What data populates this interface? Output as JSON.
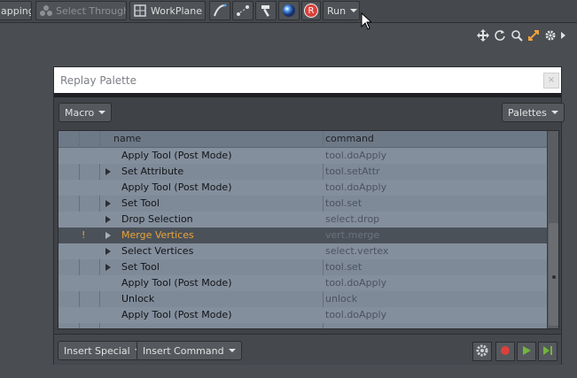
{
  "toolbar": {
    "snapping_label": "apping",
    "select_through_label": "Select Through",
    "workplane_label": "WorkPlane",
    "run_label": "Run",
    "r_badge": "R"
  },
  "palette": {
    "title": "Replay Palette",
    "close_label": "×",
    "macro_label": "Macro",
    "palettes_label": "Palettes",
    "columns": {
      "name": "name",
      "command": "command"
    },
    "rows": [
      {
        "name": "Apply Tool (Post Mode)",
        "command": "tool.doApply",
        "expandable": false,
        "alt": true,
        "selected": false,
        "mark": ""
      },
      {
        "name": "Set Attribute",
        "command": "tool.setAttr",
        "expandable": true,
        "alt": false,
        "selected": false,
        "mark": ""
      },
      {
        "name": "Apply Tool (Post Mode)",
        "command": "tool.doApply",
        "expandable": false,
        "alt": true,
        "selected": false,
        "mark": ""
      },
      {
        "name": "Set Tool",
        "command": "tool.set",
        "expandable": true,
        "alt": false,
        "selected": false,
        "mark": ""
      },
      {
        "name": "Drop Selection",
        "command": "select.drop",
        "expandable": true,
        "alt": true,
        "selected": false,
        "mark": ""
      },
      {
        "name": "Merge Vertices",
        "command": "vert.merge",
        "expandable": true,
        "alt": false,
        "selected": true,
        "mark": "!"
      },
      {
        "name": "Select Vertices",
        "command": "select.vertex",
        "expandable": true,
        "alt": true,
        "selected": false,
        "mark": ""
      },
      {
        "name": "Set Tool",
        "command": "tool.set",
        "expandable": true,
        "alt": false,
        "selected": false,
        "mark": ""
      },
      {
        "name": "Apply Tool (Post Mode)",
        "command": "tool.doApply",
        "expandable": false,
        "alt": true,
        "selected": false,
        "mark": ""
      },
      {
        "name": "Unlock",
        "command": "unlock",
        "expandable": false,
        "alt": false,
        "selected": false,
        "mark": ""
      },
      {
        "name": "Apply Tool (Post Mode)",
        "command": "tool.doApply",
        "expandable": false,
        "alt": true,
        "selected": false,
        "mark": ""
      }
    ],
    "insert_special_label": "Insert Special",
    "insert_command_label": "Insert Command"
  },
  "colors": {
    "accent_orange": "#e9a33a",
    "record_red": "#d9413b",
    "play_green": "#74b43d"
  },
  "icons": [
    "select-through-icon",
    "workplane-icon",
    "tool-pipe-icon",
    "snap-icon",
    "hammer-icon",
    "render-sphere-icon",
    "move-view-icon",
    "rotate-view-icon",
    "zoom-view-icon",
    "fit-view-icon",
    "gear-icon",
    "play-icon",
    "step-icon",
    "record-icon"
  ]
}
